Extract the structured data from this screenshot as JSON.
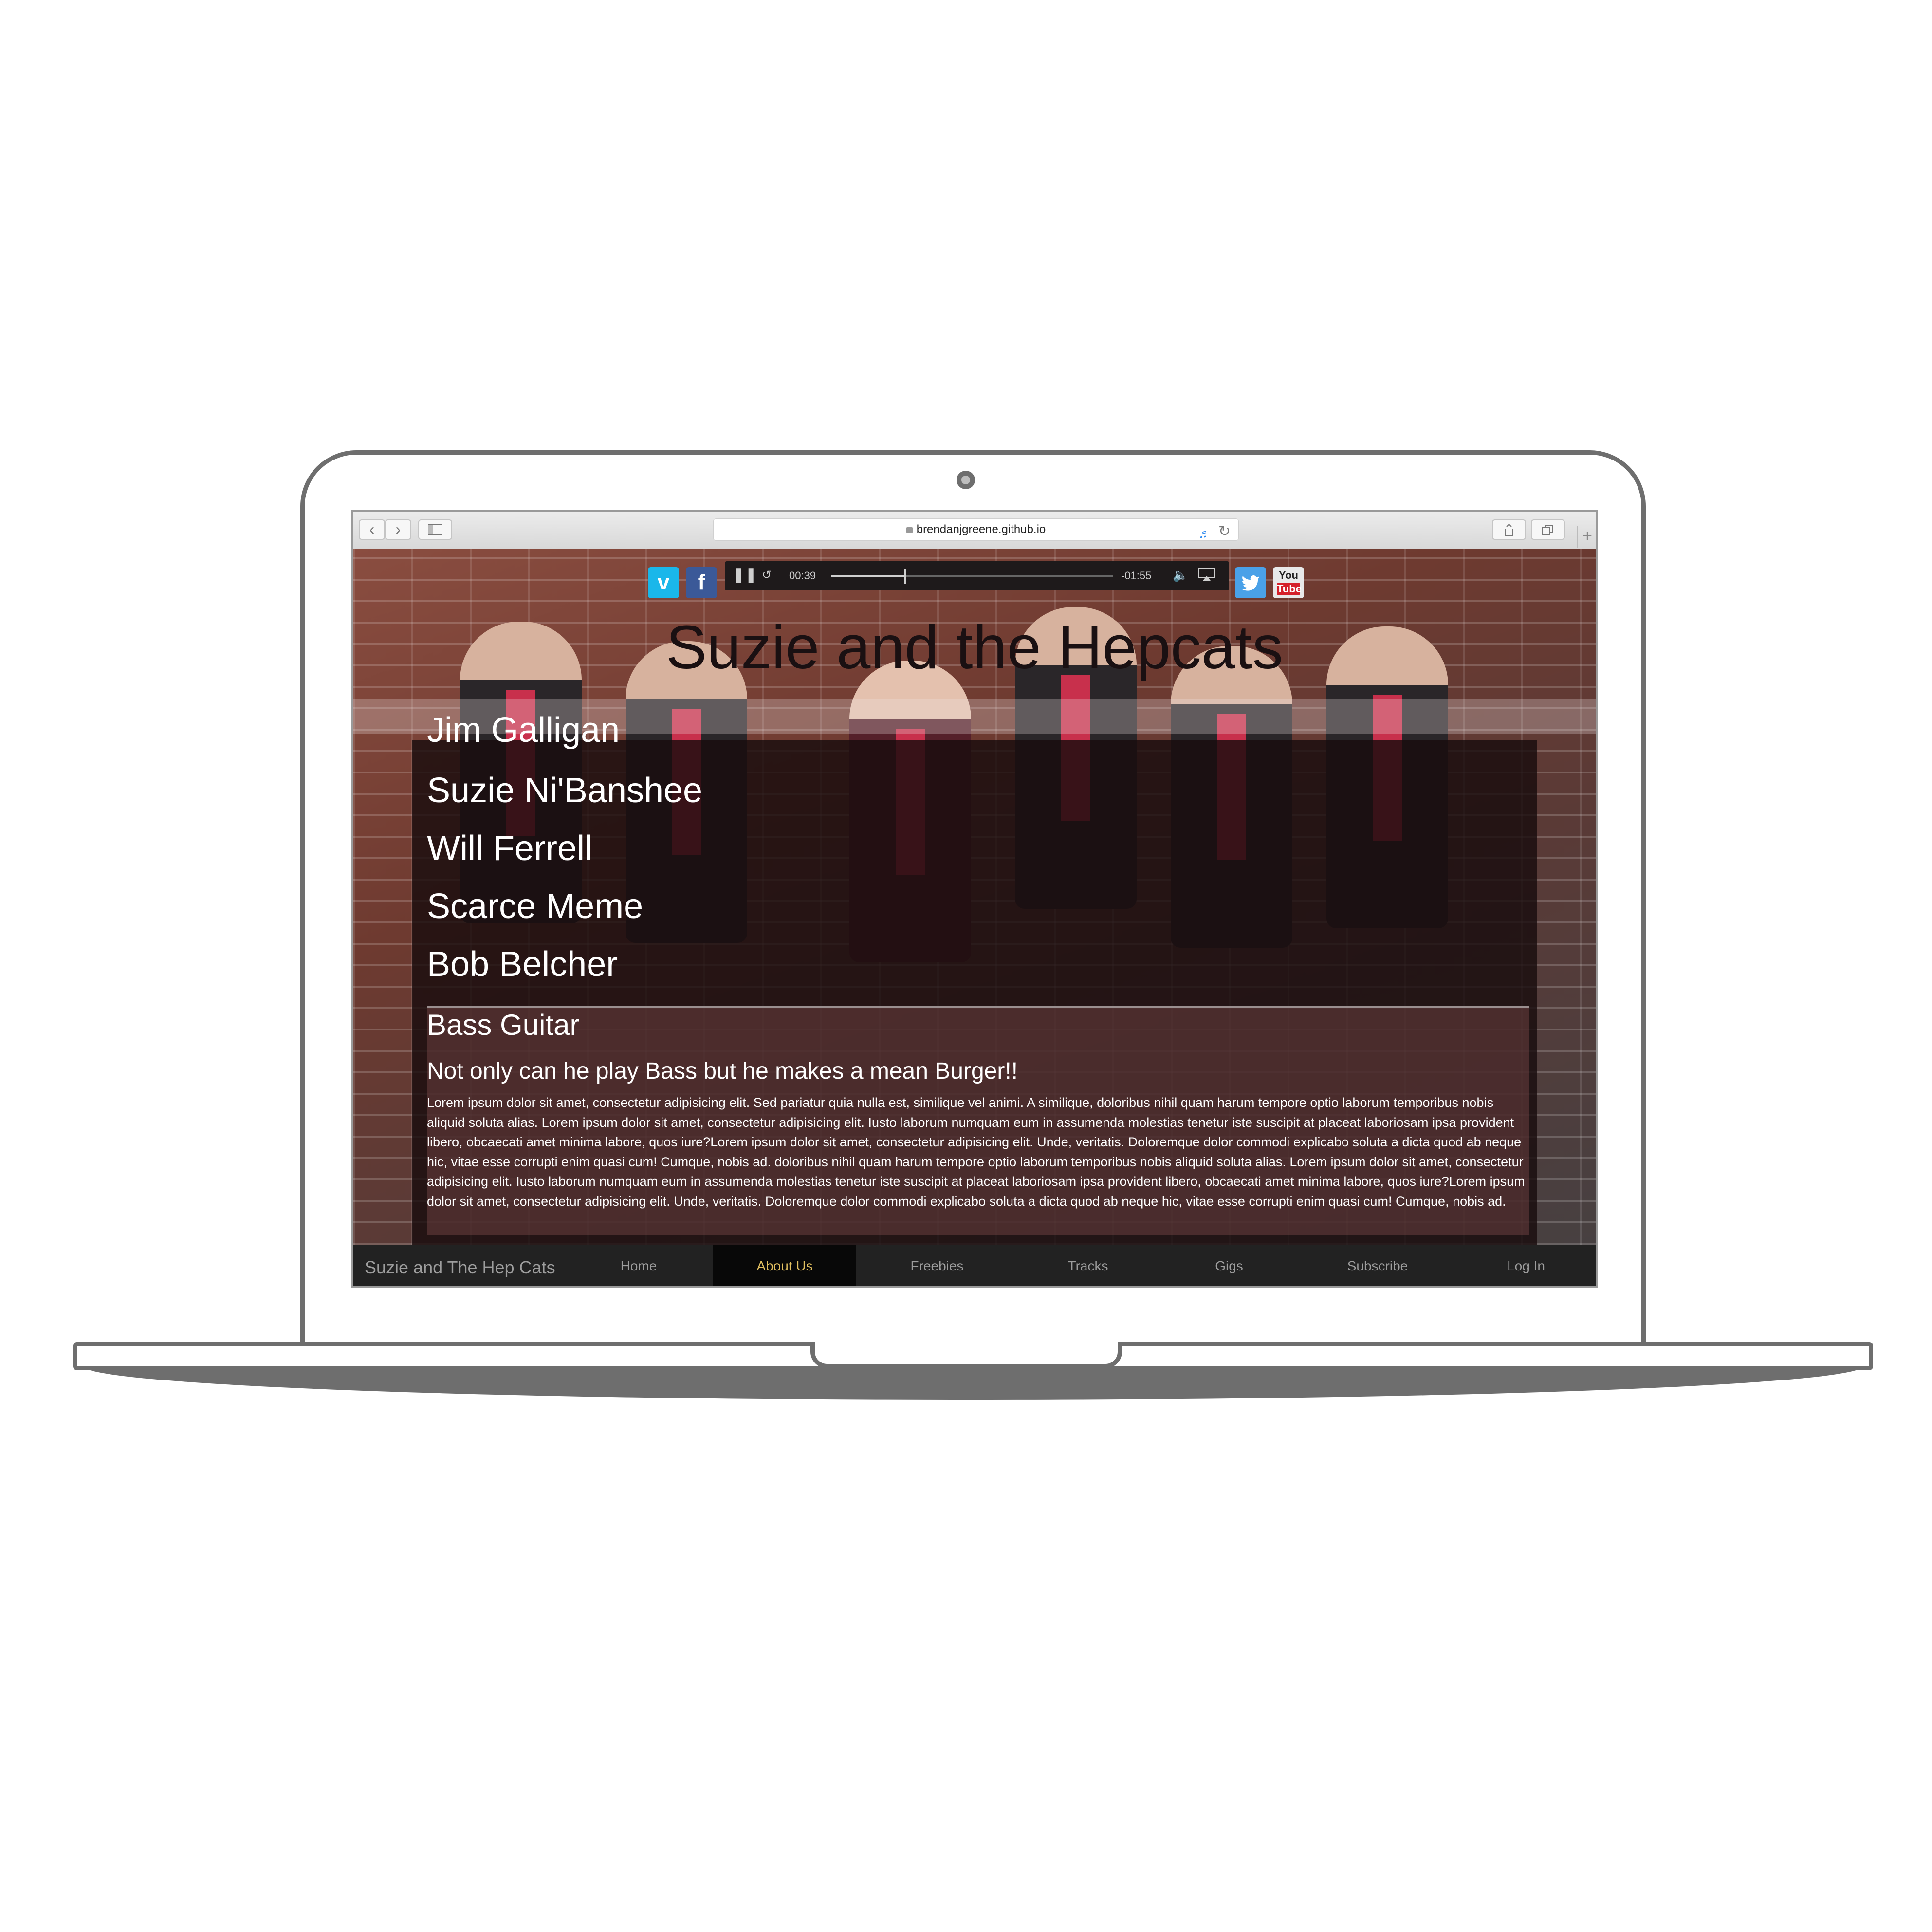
{
  "browser": {
    "url": "brendanjgreene.github.io",
    "back_icon": "‹",
    "forward_icon": "›"
  },
  "site": {
    "title": "Suzie and the Hepcats"
  },
  "social": {
    "vimeo": "v",
    "facebook": "f",
    "twitter": "t",
    "youtube_top": "You",
    "youtube_bottom": "Tube"
  },
  "player": {
    "elapsed": "00:39",
    "remaining": "-01:55",
    "progress_fraction": 0.26
  },
  "members": {
    "partial": "Jim Galligan",
    "list": [
      "Suzie Ni'Banshee",
      "Will Ferrell",
      "Scarce Meme",
      "Bob Belcher"
    ]
  },
  "detail": {
    "heading": "Bass Guitar",
    "subheading": "Not only can he play Bass but he makes a mean Burger!!",
    "body": "Lorem ipsum dolor sit amet, consectetur adipisicing elit. Sed pariatur quia nulla est, similique vel animi. A similique, doloribus nihil quam harum tempore optio laborum temporibus nobis aliquid soluta alias. Lorem ipsum dolor sit amet, consectetur adipisicing elit. Iusto laborum numquam eum in assumenda molestias tenetur iste suscipit at placeat laboriosam ipsa provident libero, obcaecati amet minima labore, quos iure?Lorem ipsum dolor sit amet, consectetur adipisicing elit. Unde, veritatis. Doloremque dolor commodi explicabo soluta a dicta quod ab neque hic, vitae esse corrupti enim quasi cum! Cumque, nobis ad. doloribus nihil quam harum tempore optio laborum temporibus nobis aliquid soluta alias. Lorem ipsum dolor sit amet, consectetur adipisicing elit. Iusto laborum numquam eum in assumenda molestias tenetur iste suscipit at placeat laboriosam ipsa provident libero, obcaecati amet minima labore, quos iure?Lorem ipsum dolor sit amet, consectetur adipisicing elit. Unde, veritatis. Doloremque dolor commodi explicabo soluta a dicta quod ab neque hic, vitae esse corrupti enim quasi cum! Cumque, nobis ad."
  },
  "navbar": {
    "brand": "Suzie and The Hep Cats",
    "items": [
      "Home",
      "About Us",
      "Freebies",
      "Tracks",
      "Gigs",
      "Subscribe",
      "Log In"
    ],
    "active": "About Us",
    "active_color": "#e2c060"
  },
  "icons": [
    "back-icon",
    "forward-icon",
    "sidebar-icon",
    "lock-icon",
    "speaker-icon",
    "reload-icon",
    "share-icon",
    "tabs-icon",
    "new-tab-icon",
    "vimeo-icon",
    "facebook-icon",
    "twitter-icon",
    "youtube-icon",
    "pause-icon",
    "rewind-icon",
    "volume-icon",
    "airplay-icon"
  ]
}
